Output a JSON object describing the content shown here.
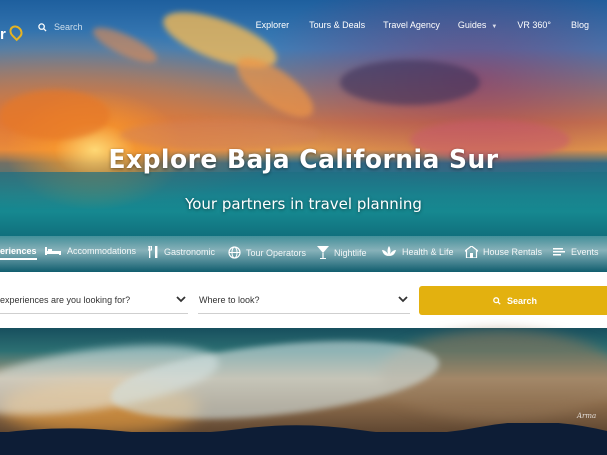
{
  "brand": {
    "logo_text": "r",
    "logo_sub": "",
    "accent": "#e3b10f"
  },
  "header": {
    "search_label": "Search",
    "nav": [
      {
        "label": "Explorer"
      },
      {
        "label": "Tours & Deals"
      },
      {
        "label": "Travel Agency"
      },
      {
        "label": "Guides",
        "has_dropdown": true
      },
      {
        "label": "VR 360°"
      },
      {
        "label": "Blog"
      }
    ]
  },
  "hero": {
    "title": "Explore Baja California Sur",
    "subtitle": "Your partners in travel planning"
  },
  "categories": [
    {
      "label": "eriences",
      "icon": "experiences-icon",
      "active": true
    },
    {
      "label": "Accommodations",
      "icon": "bed-icon"
    },
    {
      "label": "Gastronomic",
      "icon": "cutlery-icon"
    },
    {
      "label": "Tour Operators",
      "icon": "globe-icon"
    },
    {
      "label": "Nightlife",
      "icon": "cocktail-icon"
    },
    {
      "label": "Health & Life",
      "icon": "lotus-icon"
    },
    {
      "label": "House Rentals",
      "icon": "house-icon"
    },
    {
      "label": "Events",
      "icon": "calendar-icon"
    }
  ],
  "search": {
    "what_placeholder": "experiences are you looking for?",
    "where_placeholder": "Where to look?",
    "button_label": "Search"
  },
  "watermark": "Arma"
}
